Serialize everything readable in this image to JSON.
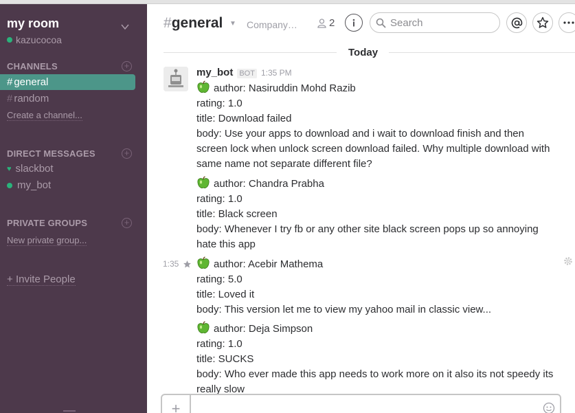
{
  "team": {
    "name": "my room",
    "user": "kazucocoa"
  },
  "sidebar": {
    "channels_heading": "CHANNELS",
    "channels": [
      {
        "label": "general",
        "active": true
      },
      {
        "label": "random",
        "active": false
      }
    ],
    "create_channel": "Create a channel...",
    "dm_heading": "DIRECT MESSAGES",
    "dms": [
      {
        "label": "slackbot",
        "icon": "heart-icon"
      },
      {
        "label": "my_bot",
        "icon": "presence-dot"
      }
    ],
    "private_heading": "PRIVATE GROUPS",
    "new_private": "New private group...",
    "invite": "Invite People",
    "invite_prefix": "+"
  },
  "header": {
    "hash": "#",
    "channel": "general",
    "purpose": "Company…",
    "member_count": "2",
    "search_placeholder": "Search"
  },
  "timeline": {
    "divider": "Today",
    "sender": {
      "name": "my_bot",
      "badge": "BOT",
      "time": "1:35 PM"
    },
    "hover_time": "1:35",
    "messages": [
      {
        "author": "author: Nasiruddin Mohd Razib",
        "rating": "rating: 1.0",
        "title": "title: Download failed",
        "body": "body:  Use your apps to download and i wait to download finish and then screen lock when unlock screen download failed. Why multiple download with same name not separate different file?"
      },
      {
        "author": "author: Chandra Prabha",
        "rating": "rating: 1.0",
        "title": "title: Black screen",
        "body": "body:  Whenever I try fb or any other site black screen pops up so annoying hate this app"
      },
      {
        "author": "author: Acebir Mathema",
        "rating": "rating: 5.0",
        "title": "title: Loved it",
        "body": "body:  This version let me to view my yahoo mail in classic view..."
      },
      {
        "author": "author: Deja Simpson",
        "rating": "rating: 1.0",
        "title": "title: SUCKS",
        "body": "body:  Who ever made this app needs to work more on it also its not speedy its really slow"
      }
    ]
  },
  "composer": {
    "plus": "+"
  },
  "colors": {
    "sidebar_bg": "#4d394b",
    "active_channel": "#4c9689",
    "presence": "#2ab27b"
  }
}
